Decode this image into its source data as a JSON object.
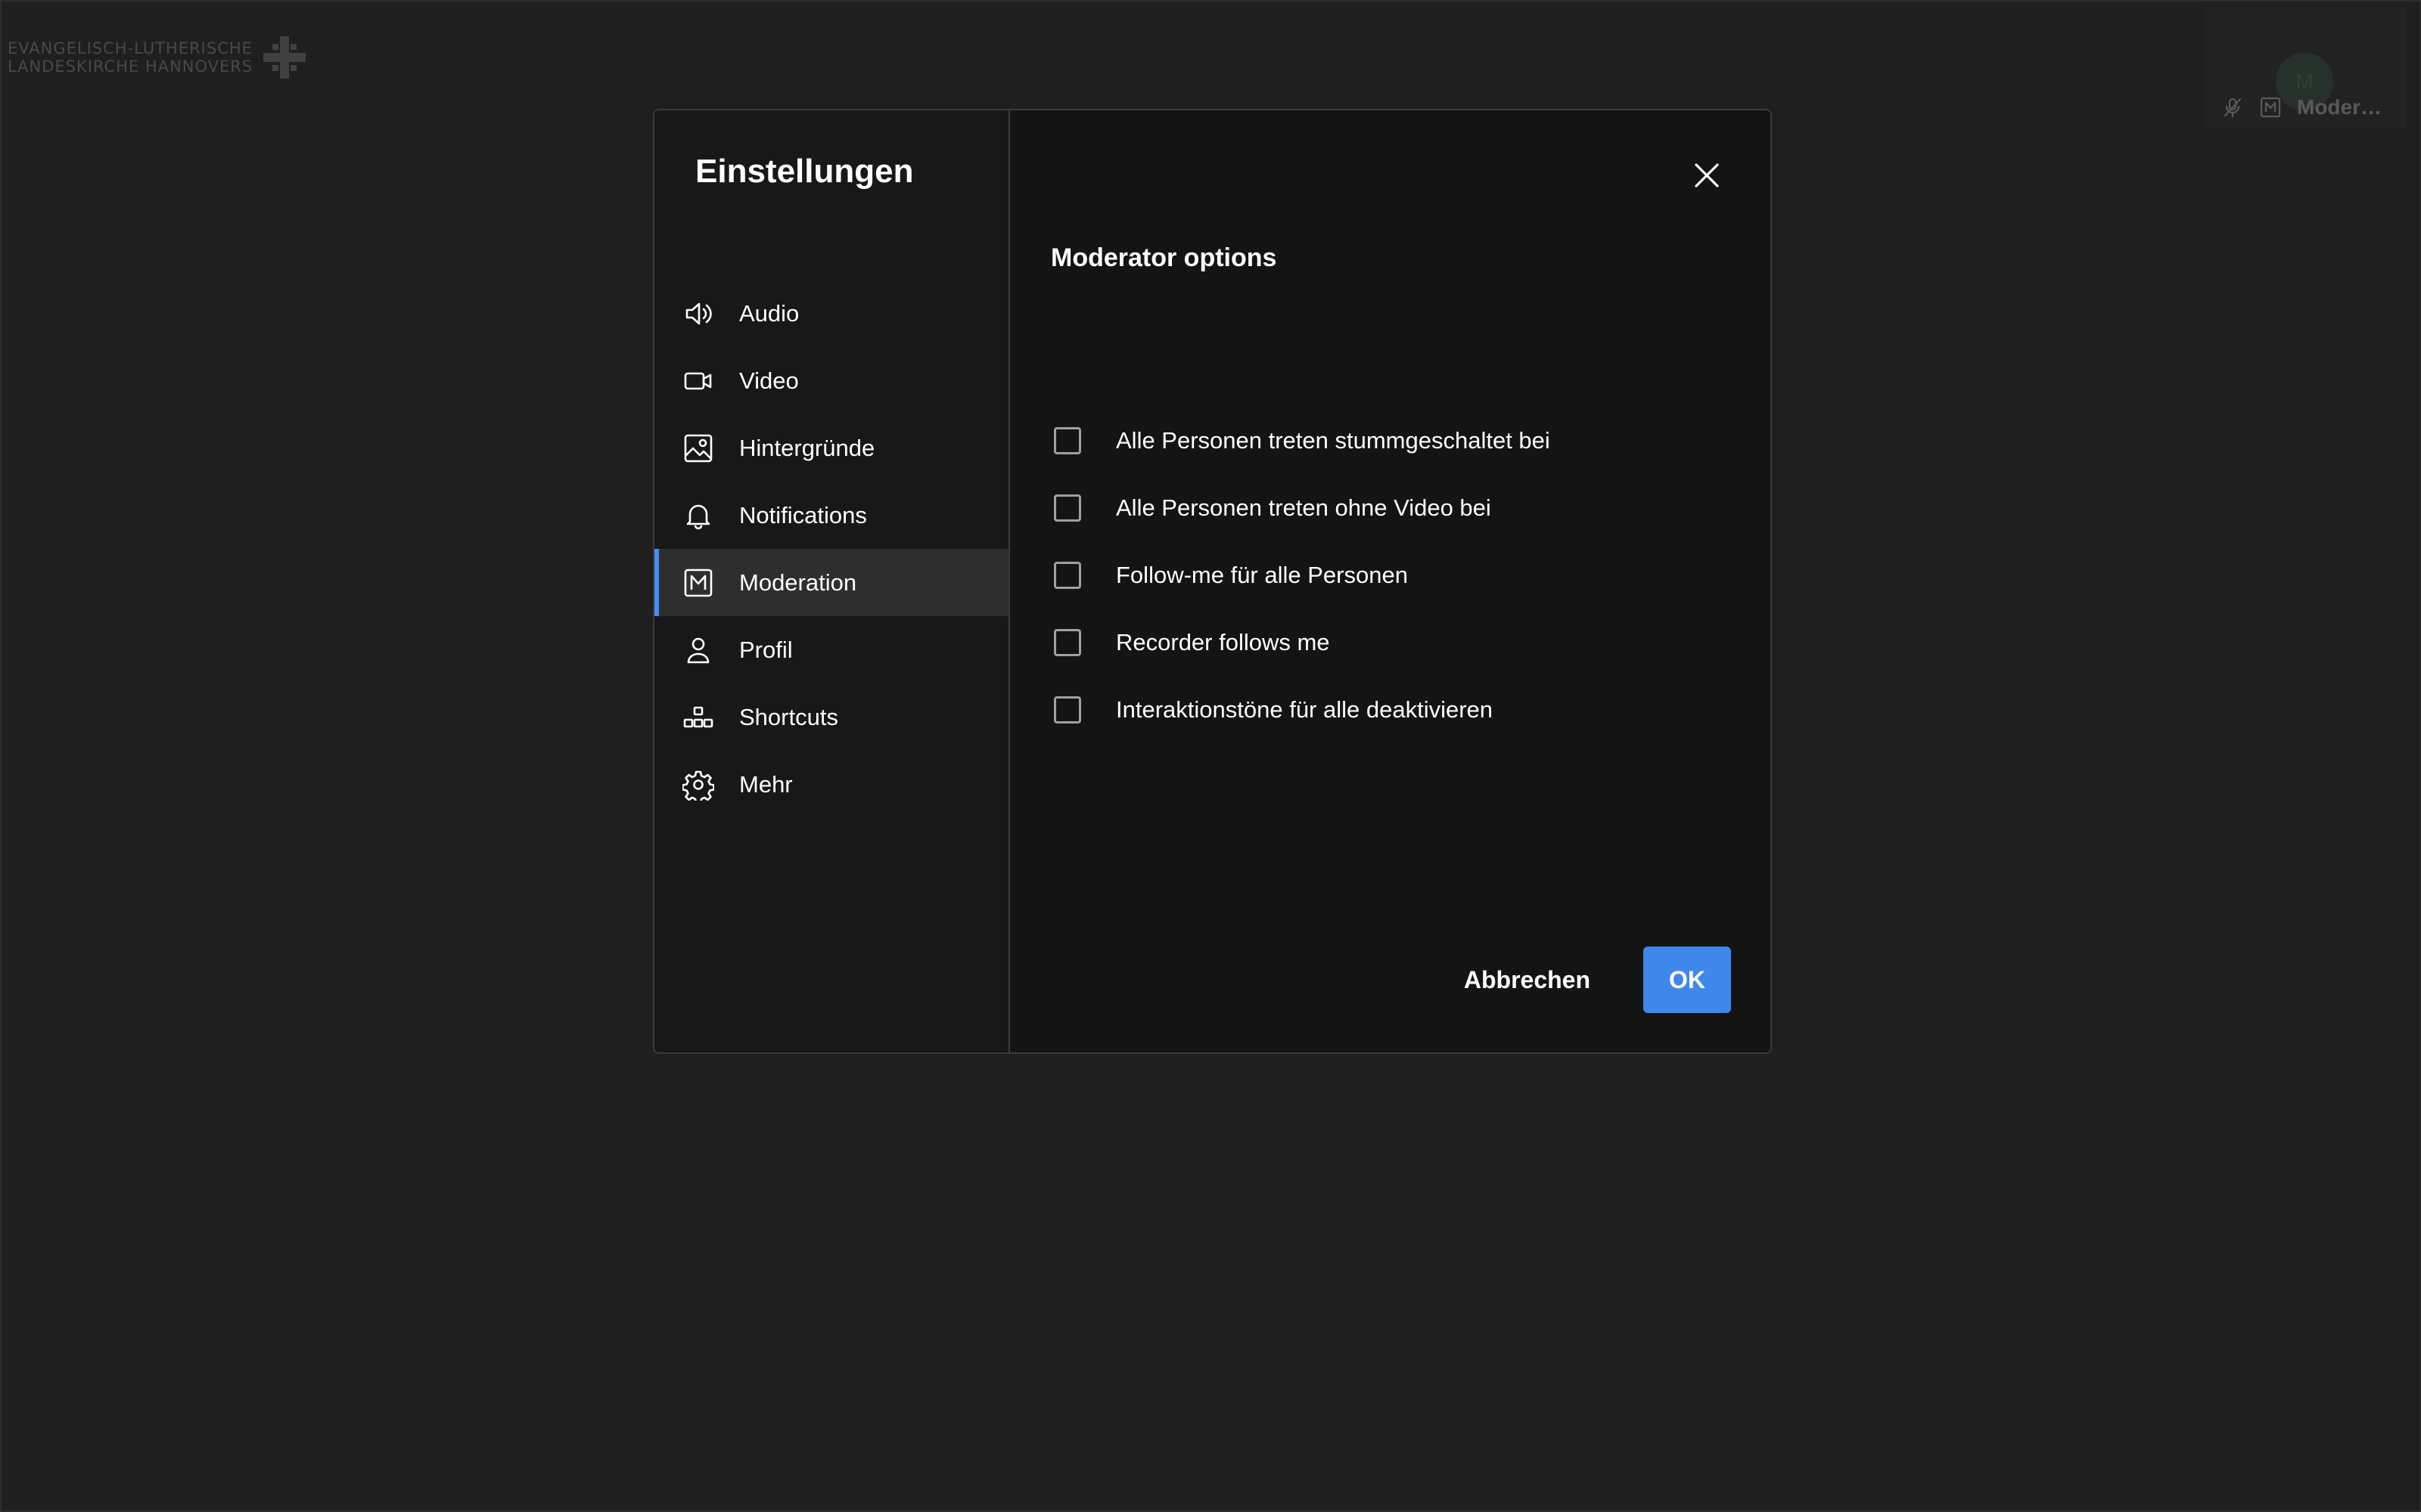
{
  "background": {
    "logo": {
      "line1": "EVANGELISCH-LUTHERISCHE",
      "line2": "LANDESKIRCHE HANNOVERS",
      "icon": "cross-emblem-icon"
    },
    "participant": {
      "avatar_initial": "M",
      "name": "Moder…",
      "icons": [
        "mic-muted-icon",
        "moderator-badge-icon"
      ]
    }
  },
  "dialog": {
    "title": "Einstellungen",
    "close_icon": "close-icon",
    "nav": [
      {
        "label": "Audio",
        "icon": "speaker-icon",
        "active": false
      },
      {
        "label": "Video",
        "icon": "video-camera-icon",
        "active": false
      },
      {
        "label": "Hintergründe",
        "icon": "image-icon",
        "active": false
      },
      {
        "label": "Notifications",
        "icon": "bell-icon",
        "active": false
      },
      {
        "label": "Moderation",
        "icon": "moderator-badge-icon",
        "active": true
      },
      {
        "label": "Profil",
        "icon": "person-icon",
        "active": false
      },
      {
        "label": "Shortcuts",
        "icon": "shortcuts-icon",
        "active": false
      },
      {
        "label": "Mehr",
        "icon": "gear-icon",
        "active": false
      }
    ],
    "section_title": "Moderator options",
    "options": [
      {
        "label": "Alle Personen treten stummgeschaltet bei",
        "checked": false
      },
      {
        "label": "Alle Personen treten ohne Video bei",
        "checked": false
      },
      {
        "label": "Follow-me für alle Personen",
        "checked": false
      },
      {
        "label": "Recorder follows me",
        "checked": false
      },
      {
        "label": "Interaktionstöne für alle deaktivieren",
        "checked": false
      }
    ],
    "buttons": {
      "cancel": "Abbrechen",
      "ok": "OK"
    },
    "colors": {
      "accent": "#3f87ea",
      "active_nav_bg": "#2e2e2e"
    }
  }
}
